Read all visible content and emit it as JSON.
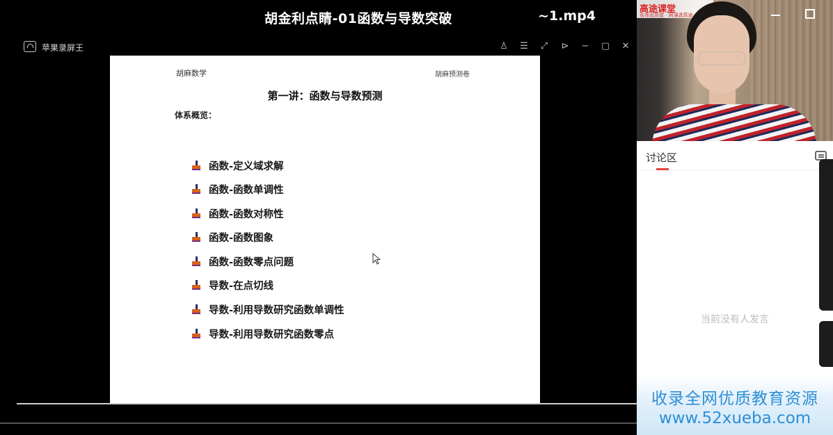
{
  "video": {
    "title": "胡金利点睛-01函数与导数突破",
    "filename_tail": "~1.mp4"
  },
  "recorder": {
    "name": "苹果录屏王",
    "controls": [
      "person-icon",
      "list-icon",
      "expand-icon",
      "pin-icon",
      "minimize-icon",
      "maximize-icon",
      "close-icon"
    ],
    "control_glyphs": [
      "♙",
      "☰",
      "⤢",
      "⊳",
      "−",
      "▢",
      "✕"
    ]
  },
  "slide": {
    "brand": "胡麻数学",
    "tag": "胡麻预测卷",
    "heading": "第一讲：函数与导数预测",
    "overview_label": "体系概览：",
    "topics": [
      "函数-定义域求解",
      "函数-函数单调性",
      "函数-函数对称性",
      "函数-函数图象",
      "函数-函数零点问题",
      "导数-在点切线",
      "导数-利用导数研究函数单调性",
      "导数-利用导数研究函数零点"
    ]
  },
  "webcam": {
    "logo_text": "高途课堂",
    "logo_sub": "名师出高徒 · 网课选高途"
  },
  "discussion": {
    "title": "讨论区",
    "empty_text": "当前没有人发言"
  },
  "watermark": {
    "line1": "收录全网优质教育资源",
    "line2": "www.52xueba.com"
  },
  "colors": {
    "accent_red": "#e0463c",
    "watermark_blue": "#2d8fd6"
  }
}
